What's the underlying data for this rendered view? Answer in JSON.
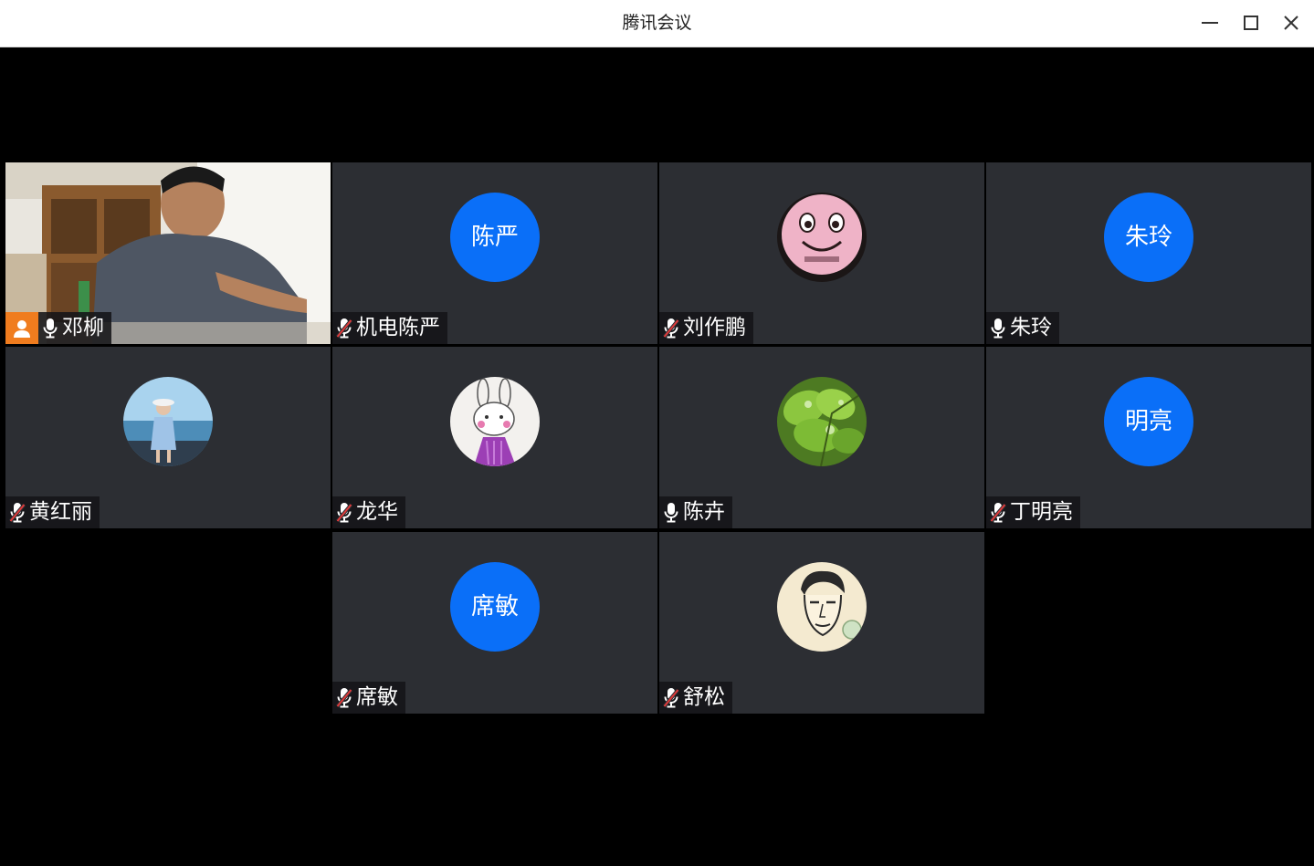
{
  "window": {
    "title": "腾讯会议",
    "controls": {
      "minimize": "minimize-icon",
      "maximize": "maximize-icon",
      "close": "close-icon"
    }
  },
  "colors": {
    "titlebar_bg": "#ffffff",
    "stage_bg": "#000000",
    "tile_bg": "#2c2e33",
    "avatar_blue": "#0a6ff8",
    "host_badge": "#f07c1e",
    "mute_red": "#e03b3b"
  },
  "participants": [
    {
      "name": "邓柳",
      "host": true,
      "mic": "on",
      "media": "video"
    },
    {
      "name": "机电陈严",
      "avatar_text": "陈严",
      "mic": "muted",
      "media": "text-avatar"
    },
    {
      "name": "刘作鹏",
      "mic": "muted",
      "media": "smiley-avatar"
    },
    {
      "name": "朱玲",
      "avatar_text": "朱玲",
      "mic": "on",
      "media": "text-avatar"
    },
    {
      "name": "黄红丽",
      "mic": "muted",
      "media": "seaside-photo-avatar"
    },
    {
      "name": "龙华",
      "mic": "muted",
      "media": "bunny-drawing-avatar"
    },
    {
      "name": "陈卉",
      "mic": "on",
      "media": "leaf-photo-avatar"
    },
    {
      "name": "丁明亮",
      "avatar_text": "明亮",
      "mic": "muted",
      "media": "text-avatar"
    },
    {
      "name": "席敏",
      "avatar_text": "席敏",
      "mic": "muted",
      "media": "text-avatar"
    },
    {
      "name": "舒松",
      "mic": "muted",
      "media": "sketch-portrait-avatar"
    }
  ]
}
